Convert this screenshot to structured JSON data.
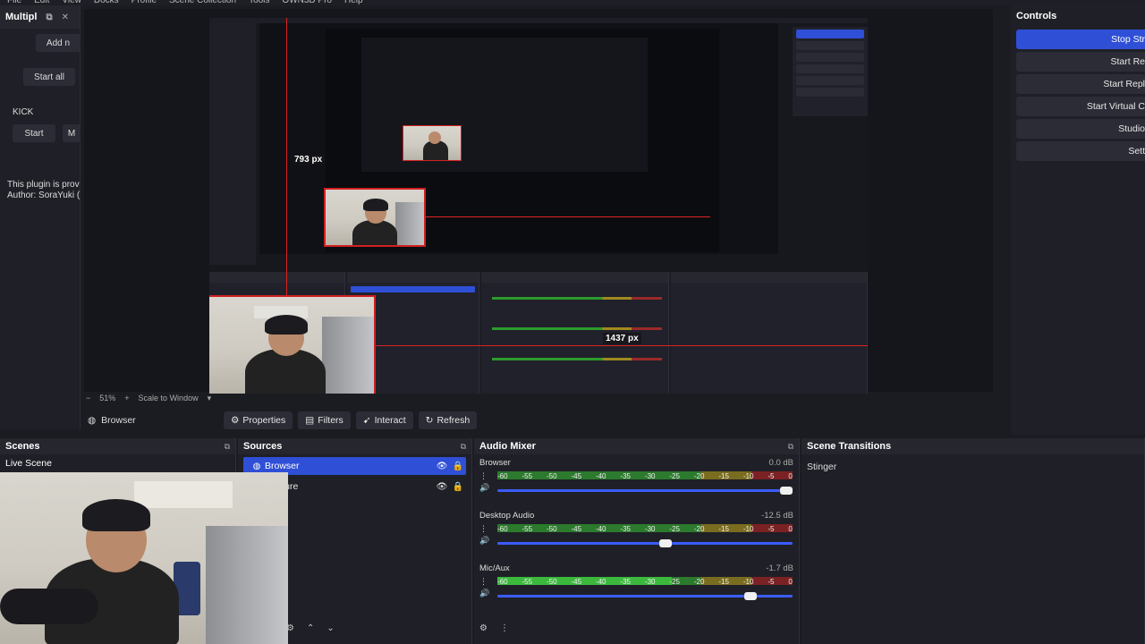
{
  "menu": [
    "File",
    "Edit",
    "View",
    "Docks",
    "Profile",
    "Scene Collection",
    "Tools",
    "OWN3D Pro",
    "Help"
  ],
  "leftdock": {
    "title": "Multipl",
    "add_label": "Add n",
    "start_all": "Start all",
    "platform": "KICK",
    "start": "Start",
    "more": "M",
    "info_line1": "This plugin is prov",
    "info_line2": "Author: SoraYuki ("
  },
  "preview": {
    "measure_vertical": "793 px",
    "measure_horizontal": "1437 px",
    "zoom": "51%",
    "scale_mode": "Scale to Window"
  },
  "controls": {
    "title": "Controls",
    "buttons": [
      "Stop Str",
      "Start Re",
      "Start Repl",
      "Start Virtual C",
      "Studio",
      "Sett"
    ]
  },
  "source_toolbar": {
    "name": "Browser",
    "properties": "Properties",
    "filters": "Filters",
    "interact": "Interact",
    "refresh": "Refresh"
  },
  "scenes": {
    "title": "Scenes",
    "items": [
      "Live Scene"
    ]
  },
  "sources": {
    "title": "Sources",
    "items": [
      {
        "name": "Browser",
        "selected": true
      },
      {
        "name": "Capture",
        "selected": false
      }
    ]
  },
  "mixer": {
    "title": "Audio Mixer",
    "scale": [
      "-60",
      "-55",
      "-50",
      "-45",
      "-40",
      "-35",
      "-30",
      "-25",
      "-20",
      "-15",
      "-10",
      "-5",
      "0"
    ],
    "channels": [
      {
        "name": "Browser",
        "db": "0.0 dB",
        "level": 0.0,
        "fader": 1.0
      },
      {
        "name": "Desktop Audio",
        "db": "-12.5 dB",
        "level": 0.0,
        "fader": 0.59
      },
      {
        "name": "Mic/Aux",
        "db": "-1.7 dB",
        "level": 0.59,
        "fader": 0.88
      }
    ]
  },
  "transitions": {
    "title": "Scene Transitions",
    "current": "Stinger"
  },
  "colors": {
    "accent": "#2f4fd6",
    "guide": "#e02222",
    "panel": "#1f2027"
  }
}
